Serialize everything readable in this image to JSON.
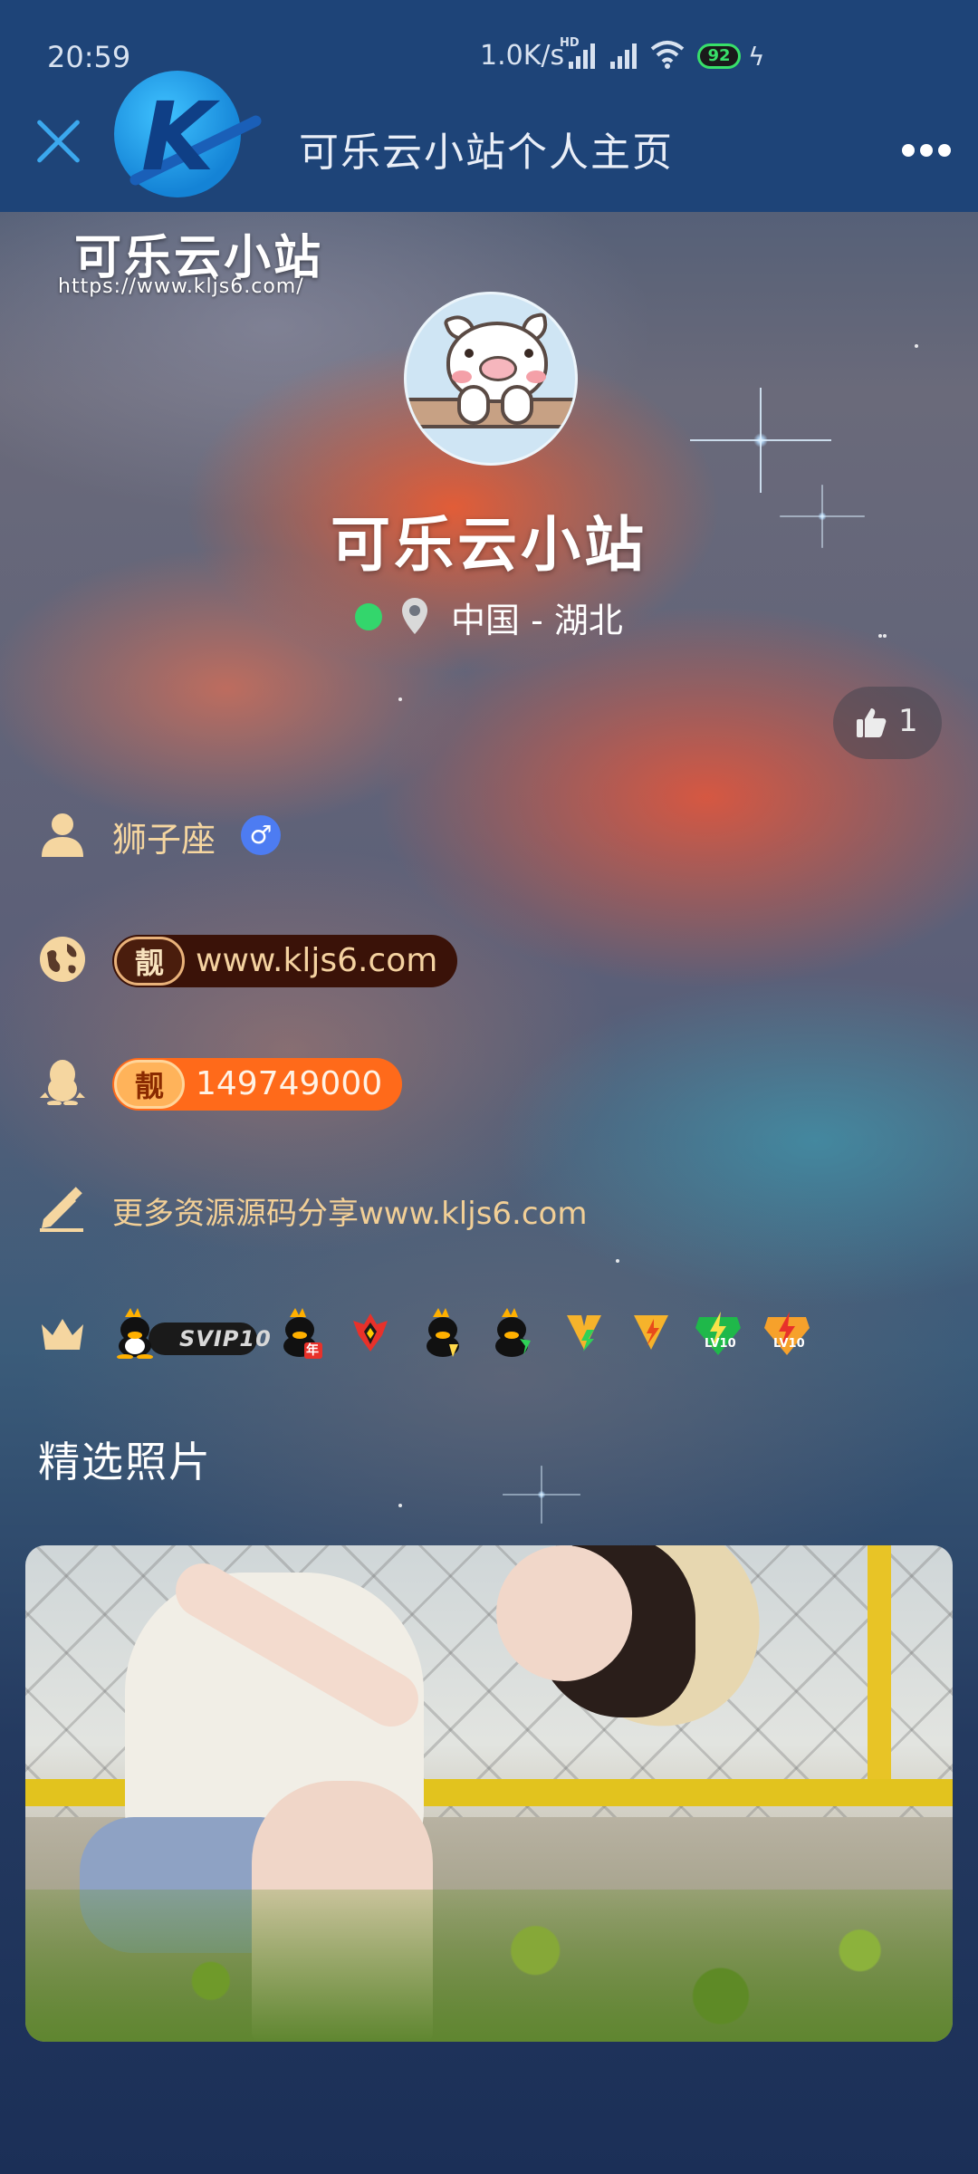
{
  "status_bar": {
    "time": "20:59",
    "speed": "1.0K/s",
    "network": "HD",
    "battery": "92"
  },
  "header": {
    "title": "可乐云小站个人主页"
  },
  "watermark": {
    "name": "可乐云小站",
    "url": "https://www.kljs6.com/"
  },
  "profile": {
    "name": "可乐云小站",
    "location": "中国 - 湖北",
    "likes": "1",
    "zodiac": "狮子座",
    "gender_symbol": "♂",
    "website_tag": "靓",
    "website": "www.kljs6.com",
    "qq_tag": "靓",
    "qq": "149749000",
    "signature": "更多资源源码分享www.kljs6.com"
  },
  "badges": {
    "svip": "SVIP10",
    "year_mark": "年",
    "lv_label_1": "LV10",
    "lv_label_2": "LV10"
  },
  "photos": {
    "section_title": "精选照片"
  },
  "colors": {
    "header_bg": "#1e4478",
    "accent_blue": "#3ba8ee",
    "online_green": "#33d66c",
    "qq_orange": "#ff6a1a",
    "gold_text": "#f2cf96"
  }
}
